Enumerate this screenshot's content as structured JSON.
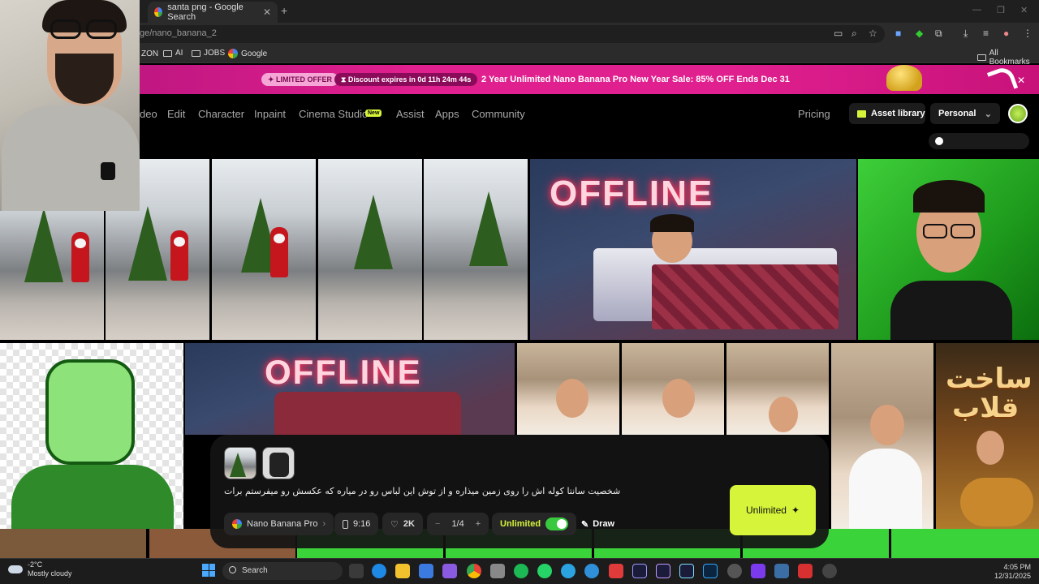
{
  "browser": {
    "tab_title": "santa png - Google Search",
    "url": "ge/nano_banana_2",
    "bookmarks": [
      "ZON",
      "AI",
      "JOBS",
      "Google"
    ],
    "all_bookmarks": "All Bookmarks"
  },
  "promo": {
    "offer": "LIMITED OFFER",
    "discount": "Discount expires in 0d 11h 24m 44s",
    "text": "2 Year Unlimited Nano Banana Pro New Year Sale: 85% OFF Ends Dec 31"
  },
  "nav": {
    "links": [
      "deo",
      "Edit",
      "Character",
      "Inpaint",
      "Cinema Studio",
      "Assist",
      "Apps",
      "Community"
    ],
    "new_badge": "New",
    "pricing": "Pricing",
    "asset_library": "Asset library",
    "workspace": "Personal"
  },
  "gallery": {
    "offline_text": "OFFLINE",
    "poster_line1": "ساخت",
    "poster_line2": "قلاب"
  },
  "prompt": {
    "text": "شخصیت سانتا  کوله اش را روی زمین میذاره و از توش این لباس رو در میاره که عکسش رو میفرستم برات",
    "model": "Nano Banana Pro",
    "aspect": "9:16",
    "resolution": "2K",
    "count": "1/4",
    "unlimited_label": "Unlimited",
    "draw": "Draw",
    "generate": "Unlimited"
  },
  "taskbar": {
    "temp": "-2°C",
    "weather": "Mostly cloudy",
    "search": "Search",
    "time": "4:05 PM",
    "date": "12/31/2025"
  },
  "colors": {
    "accent": "#d6f53a",
    "promo": "#e0208f",
    "toggle": "#39c93f"
  }
}
